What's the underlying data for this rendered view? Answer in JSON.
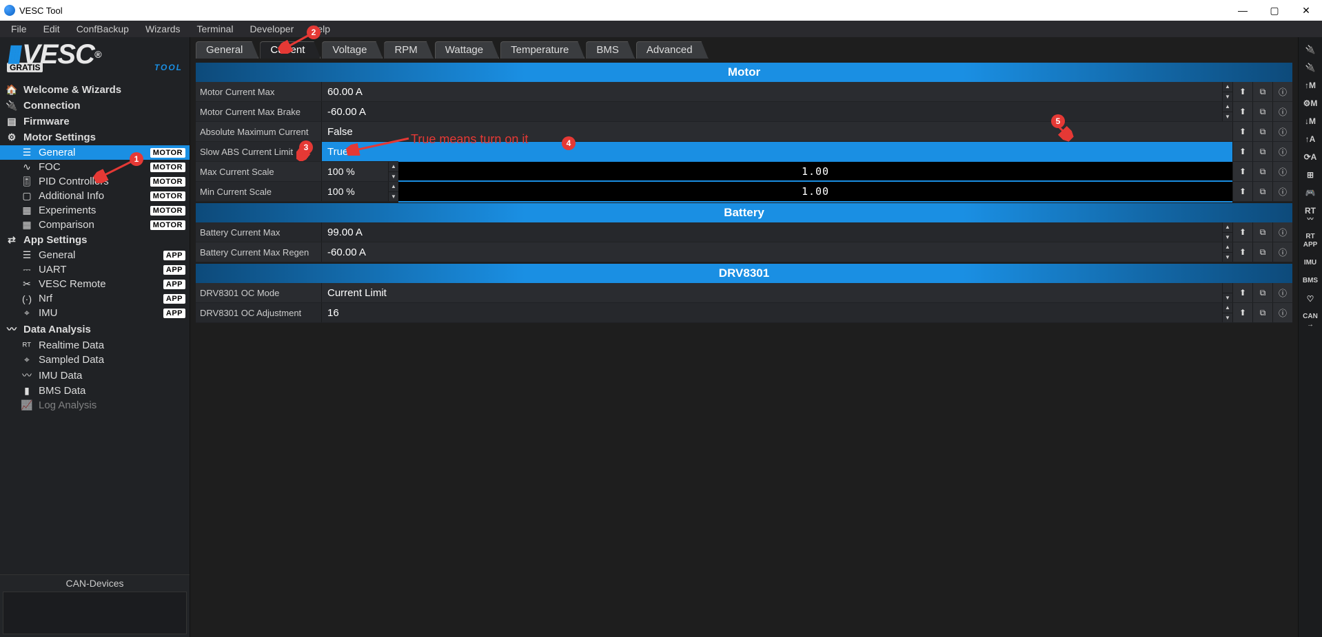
{
  "window": {
    "title": "VESC Tool"
  },
  "menu": [
    "File",
    "Edit",
    "ConfBackup",
    "Wizards",
    "Terminal",
    "Developer",
    "Help"
  ],
  "brand": {
    "name": "VESC",
    "sub1": "GRATIS",
    "sub2": "TOOL"
  },
  "tree": {
    "categories": [
      {
        "label": "Welcome & Wizards",
        "icon": "home"
      },
      {
        "label": "Connection",
        "icon": "plug"
      },
      {
        "label": "Firmware",
        "icon": "chip"
      },
      {
        "label": "Motor Settings",
        "icon": "gear",
        "items": [
          {
            "label": "General",
            "badge": "MOTOR",
            "icon": "sliders",
            "active": true
          },
          {
            "label": "FOC",
            "badge": "MOTOR",
            "icon": "wave"
          },
          {
            "label": "PID Controllers",
            "badge": "MOTOR",
            "icon": "tune"
          },
          {
            "label": "Additional Info",
            "badge": "MOTOR",
            "icon": "info"
          },
          {
            "label": "Experiments",
            "badge": "MOTOR",
            "icon": "calc"
          },
          {
            "label": "Comparison",
            "badge": "MOTOR",
            "icon": "calc"
          }
        ]
      },
      {
        "label": "App Settings",
        "icon": "sliders2",
        "items": [
          {
            "label": "General",
            "badge": "APP",
            "icon": "sliders"
          },
          {
            "label": "UART",
            "badge": "APP",
            "icon": "serial"
          },
          {
            "label": "VESC Remote",
            "badge": "APP",
            "icon": "remote"
          },
          {
            "label": "Nrf",
            "badge": "APP",
            "icon": "radio"
          },
          {
            "label": "IMU",
            "badge": "APP",
            "icon": "compass"
          }
        ]
      },
      {
        "label": "Data Analysis",
        "icon": "chart",
        "items": [
          {
            "label": "Realtime Data",
            "icon": "rt"
          },
          {
            "label": "Sampled Data",
            "icon": "compass"
          },
          {
            "label": "IMU Data",
            "icon": "chart"
          },
          {
            "label": "BMS Data",
            "icon": "battery"
          },
          {
            "label": "Log Analysis",
            "icon": "log"
          }
        ]
      }
    ],
    "can_devices": "CAN-Devices"
  },
  "tabs": [
    "General",
    "Current",
    "Voltage",
    "RPM",
    "Wattage",
    "Temperature",
    "BMS",
    "Advanced"
  ],
  "active_tab": "Current",
  "sections": {
    "motor": {
      "title": "Motor",
      "rows": {
        "motor_current_max": {
          "label": "Motor Current Max",
          "value": "60.00 A"
        },
        "motor_current_max_brake": {
          "label": "Motor Current Max Brake",
          "value": "-60.00 A"
        },
        "abs_max_current": {
          "label": "Absolute Maximum Current",
          "dropdown_open": true,
          "options": [
            "False",
            "True"
          ],
          "selected": "True"
        },
        "slow_abs": {
          "label": "Slow ABS Current Limit"
        },
        "max_current_scale": {
          "label": "Max Current Scale",
          "pct": "100 %",
          "slider": "1.00"
        },
        "min_current_scale": {
          "label": "Min Current Scale",
          "pct": "100 %",
          "slider": "1.00"
        }
      }
    },
    "battery": {
      "title": "Battery",
      "rows": {
        "battery_current_max": {
          "label": "Battery Current Max",
          "value": "99.00 A"
        },
        "battery_current_max_regen": {
          "label": "Battery Current Max Regen",
          "value": "-60.00 A"
        }
      }
    },
    "drv": {
      "title": "DRV8301",
      "rows": {
        "oc_mode": {
          "label": "DRV8301 OC Mode",
          "value": "Current Limit"
        },
        "oc_adj": {
          "label": "DRV8301 OC Adjustment",
          "value": "16"
        }
      }
    }
  },
  "rightbar": [
    "🔌",
    "🔌",
    "↑M",
    "⚙M",
    "↓M",
    "↑A",
    "⟳A",
    "🎮",
    "🎮",
    "RT",
    "RT\nAPP",
    "IMU",
    "BMS",
    "♡",
    "CAN"
  ],
  "annotations": {
    "text1": "True means turn on it"
  }
}
